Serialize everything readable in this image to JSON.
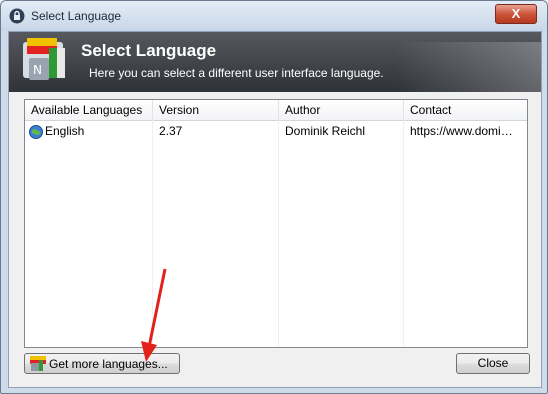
{
  "window": {
    "title": "Select Language",
    "close_glyph": "X"
  },
  "banner": {
    "title": "Select Language",
    "subtitle": "Here you can select a different user interface language."
  },
  "columns": [
    {
      "label": "Available Languages"
    },
    {
      "label": "Version"
    },
    {
      "label": "Author"
    },
    {
      "label": "Contact"
    }
  ],
  "rows": [
    {
      "language": "English",
      "version": "2.37",
      "author": "Dominik Reichl",
      "contact": "https://www.domi…",
      "icon": "globe-icon"
    }
  ],
  "buttons": {
    "more_languages": "Get more languages...",
    "close": "Close"
  },
  "colors": {
    "banner": "#2f3237",
    "arrow": "#e3211b"
  }
}
